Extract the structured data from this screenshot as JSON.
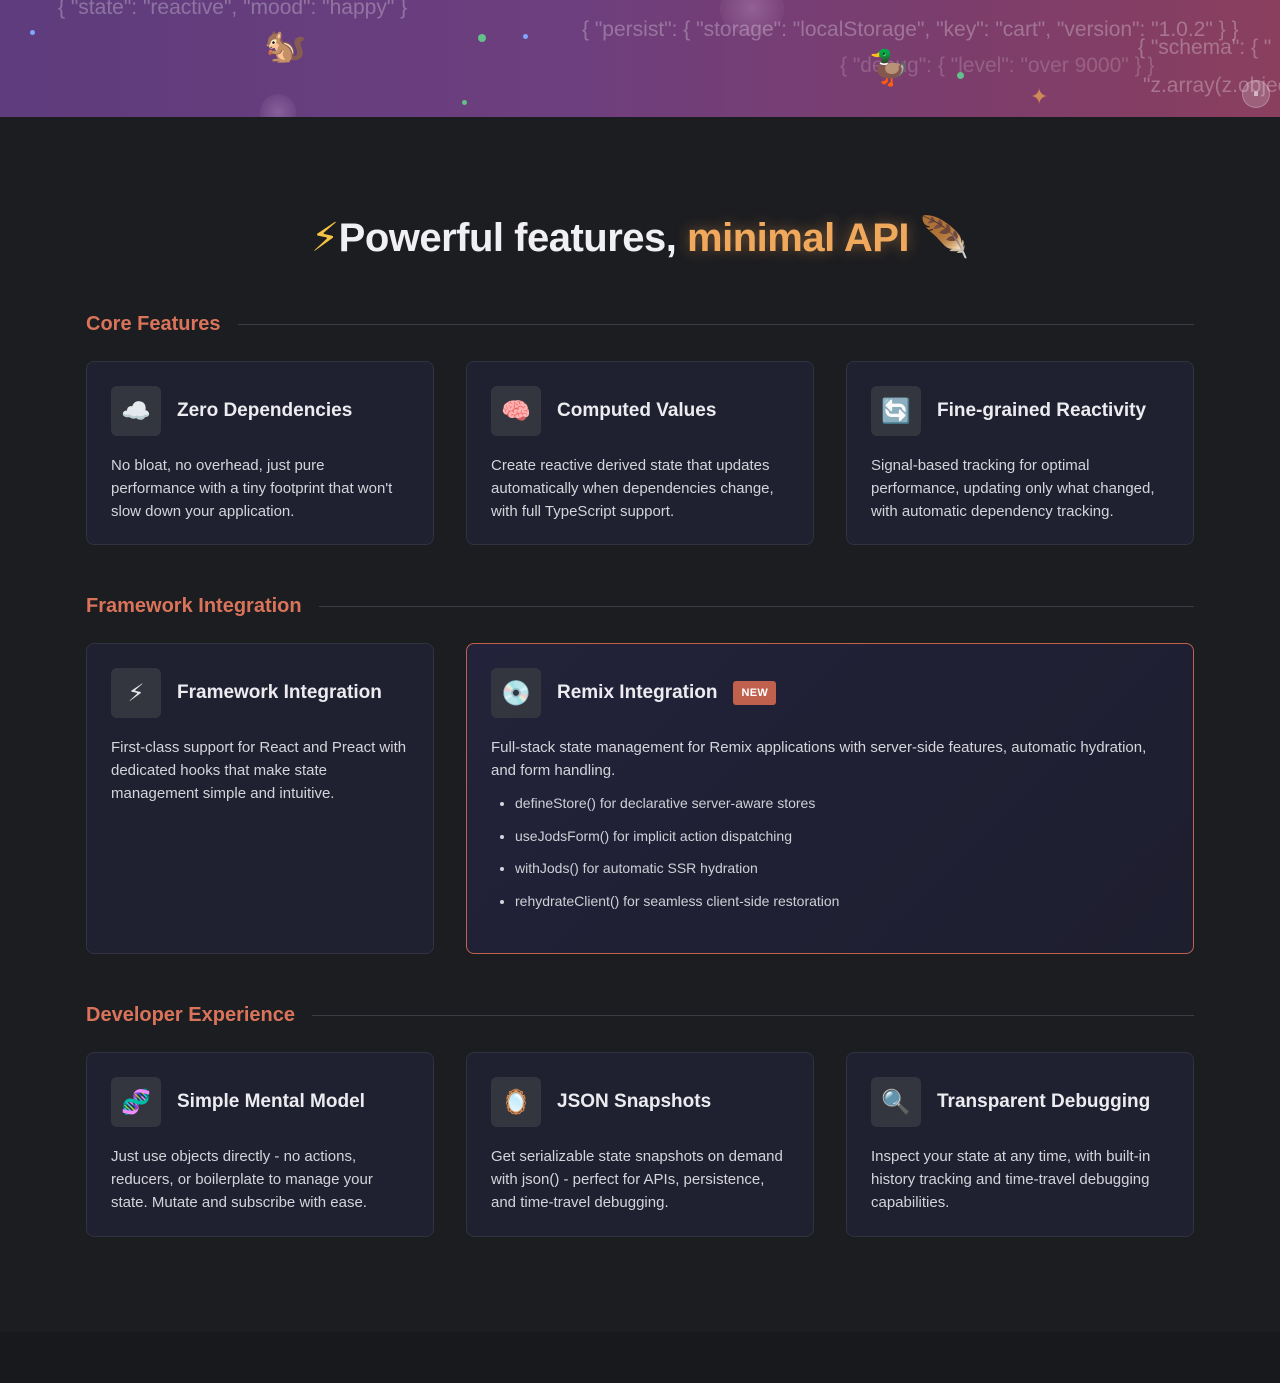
{
  "hero": {
    "code_snippets": [
      "{ \"state\": \"reactive\", \"mood\": \"happy\" }",
      "{ \"persist\": { \"storage\": \"localStorage\", \"key\": \"cart\", \"version\": \"1.0.2\" } }",
      "{ \"schema\": { \"",
      "{ \"debug\": { \"level\": \"over 9000\" } }",
      "\"z.array(z.objec"
    ],
    "emojis": {
      "squirrel": "🐿️",
      "duck": "🦆"
    },
    "pause_label": "⏸"
  },
  "main_title": {
    "icon_left": "⚡",
    "text": "Powerful features,",
    "accent": "minimal API",
    "icon_right": "🪶"
  },
  "sections": [
    {
      "title": "Core Features",
      "cards": [
        {
          "icon": "☁️",
          "icon_name": "cloud-icon",
          "title": "Zero Dependencies",
          "desc": "No bloat, no overhead, just pure performance with a tiny footprint that won't slow down your application."
        },
        {
          "icon": "🧠",
          "icon_name": "brain-icon",
          "title": "Computed Values",
          "desc": "Create reactive derived state that updates automatically when dependencies change, with full TypeScript support."
        },
        {
          "icon": "🔄",
          "icon_name": "refresh-icon",
          "title": "Fine-grained Reactivity",
          "desc": "Signal-based tracking for optimal performance, updating only what changed, with automatic dependency tracking."
        }
      ]
    },
    {
      "title": "Framework Integration",
      "cards": [
        {
          "icon": "⚡",
          "icon_name": "lightning-icon",
          "title": "Framework Integration",
          "desc": "First-class support for React and Preact with dedicated hooks that make state management simple and intuitive."
        },
        {
          "icon": "💿",
          "icon_name": "disc-icon",
          "title": "Remix Integration",
          "badge": "NEW",
          "desc": "Full-stack state management for Remix applications with server-side features, automatic hydration, and form handling.",
          "bullets": [
            "defineStore() for declarative server-aware stores",
            "useJodsForm() for implicit action dispatching",
            "withJods() for automatic SSR hydration",
            "rehydrateClient() for seamless client-side restoration"
          ]
        }
      ]
    },
    {
      "title": "Developer Experience",
      "cards": [
        {
          "icon": "🧬",
          "icon_name": "dna-icon",
          "title": "Simple Mental Model",
          "desc": "Just use objects directly - no actions, reducers, or boilerplate to manage your state. Mutate and subscribe with ease."
        },
        {
          "icon": "🪞",
          "icon_name": "mirror-icon",
          "title": "JSON Snapshots",
          "desc": "Get serializable state snapshots on demand with json() - perfect for APIs, persistence, and time-travel debugging."
        },
        {
          "icon": "🔍",
          "icon_name": "magnifier-icon",
          "title": "Transparent Debugging",
          "desc": "Inspect your state at any time, with built-in history tracking and time-travel debugging capabilities."
        }
      ]
    }
  ],
  "colors": {
    "accent": "#d9735a",
    "title_accent": "#f0a85c",
    "card_bg": "#1f2030",
    "page_bg": "#1c1d21"
  }
}
